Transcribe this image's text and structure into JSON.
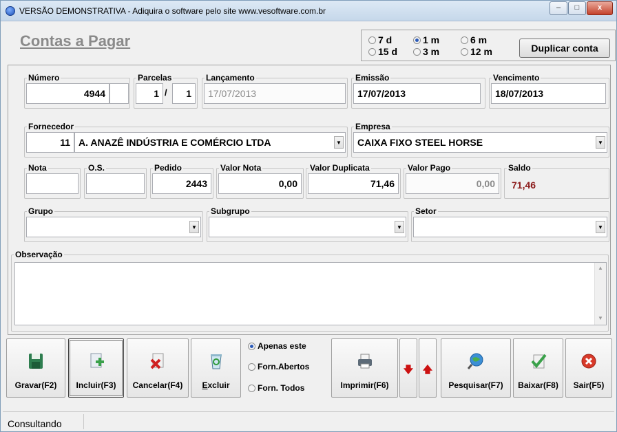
{
  "window": {
    "title": "VERSÃO DEMONSTRATIVA - Adiquira o software pelo site www.vesoftware.com.br"
  },
  "page": {
    "title": "Contas a Pagar"
  },
  "period": {
    "options": [
      {
        "label": "7 d",
        "selected": false
      },
      {
        "label": "1 m",
        "selected": true
      },
      {
        "label": "6 m",
        "selected": false
      },
      {
        "label": "15 d",
        "selected": false
      },
      {
        "label": "3 m",
        "selected": false
      },
      {
        "label": "12 m",
        "selected": false
      }
    ]
  },
  "duplicar_label": "Duplicar conta",
  "fields": {
    "numero": {
      "label": "Número",
      "value": "4944"
    },
    "parcelas": {
      "label": "Parcelas",
      "current": "1",
      "sep": "/",
      "total": "1"
    },
    "lancamento": {
      "label": "Lançamento",
      "value": "17/07/2013"
    },
    "emissao": {
      "label": "Emissão",
      "value": "17/07/2013"
    },
    "vencimento": {
      "label": "Vencimento",
      "value": "18/07/2013"
    },
    "fornecedor": {
      "label": "Fornecedor",
      "code": "11",
      "name": "A. ANAZÊ INDÚSTRIA E COMÉRCIO LTDA"
    },
    "empresa": {
      "label": "Empresa",
      "value": "CAIXA FIXO STEEL HORSE"
    },
    "nota": {
      "label": "Nota",
      "value": ""
    },
    "os": {
      "label": "O.S.",
      "value": ""
    },
    "pedido": {
      "label": "Pedido",
      "value": "2443"
    },
    "valor_nota": {
      "label": "Valor Nota",
      "value": "0,00"
    },
    "valor_duplicata": {
      "label": "Valor Duplicata",
      "value": "71,46"
    },
    "valor_pago": {
      "label": "Valor Pago",
      "value": "0,00"
    },
    "saldo": {
      "label": "Saldo",
      "value": "71,46"
    },
    "grupo": {
      "label": "Grupo",
      "value": ""
    },
    "subgrupo": {
      "label": "Subgrupo",
      "value": ""
    },
    "setor": {
      "label": "Setor",
      "value": ""
    },
    "observacao": {
      "label": "Observação",
      "value": ""
    }
  },
  "toolbar": {
    "gravar": "Gravar(F2)",
    "incluir": "Incluir(F3)",
    "cancelar": "Cancelar(F4)",
    "excluir_u": "E",
    "excluir_rest": "xcluir",
    "filter": [
      {
        "label": "Apenas este",
        "selected": true
      },
      {
        "label": "Forn.Abertos",
        "selected": false
      },
      {
        "label": "Forn. Todos",
        "selected": false
      }
    ],
    "imprimir": "Imprimir(F6)",
    "pesquisar": "Pesquisar(F7)",
    "baixar": "Baixar(F8)",
    "sair": "Sair(F5)"
  },
  "status": {
    "text": "Consultando"
  },
  "colors": {
    "saldo": "#8b1a1a",
    "title": "#8a8a8a"
  }
}
